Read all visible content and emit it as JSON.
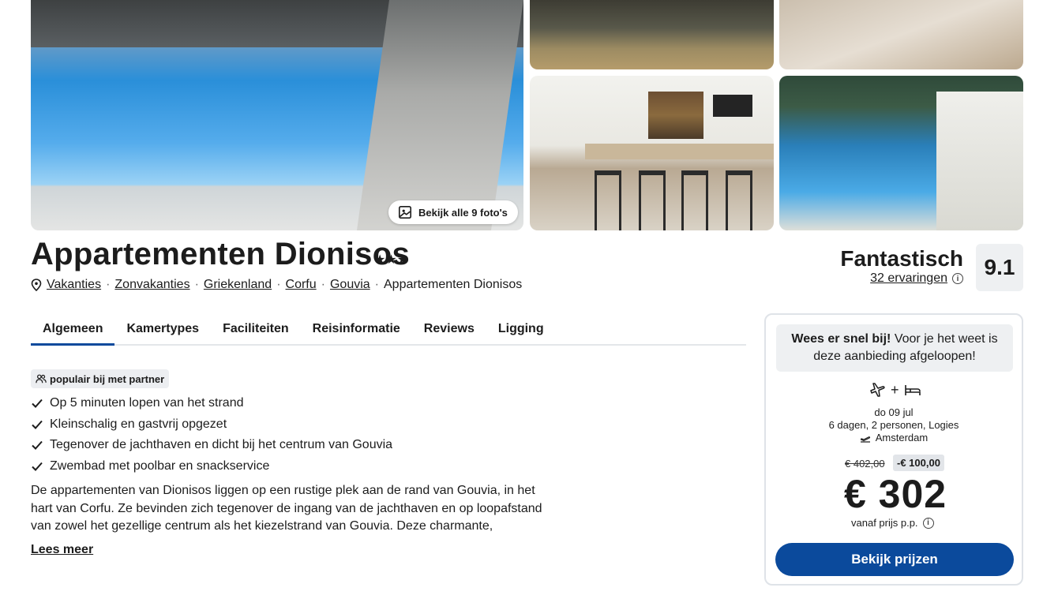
{
  "gallery": {
    "photos_button_label": "Bekijk alle 9 foto's",
    "icon": "images-icon"
  },
  "hotel": {
    "name": "Appartementen Dionisos",
    "stars": "★★★",
    "star_count": 3
  },
  "breadcrumb": {
    "icon": "location-pin-icon",
    "items": [
      "Vakanties",
      "Zonvakanties",
      "Griekenland",
      "Corfu",
      "Gouvia"
    ],
    "current": "Appartementen Dionisos",
    "separator": "·"
  },
  "rating": {
    "label": "Fantastisch",
    "count_text": "32 ervaringen",
    "score": "9.1"
  },
  "tabs": [
    "Algemeen",
    "Kamertypes",
    "Faciliteiten",
    "Reisinformatie",
    "Reviews",
    "Ligging"
  ],
  "active_tab": "Algemeen",
  "badge": "populair bij met partner",
  "usps": [
    "Op 5 minuten lopen van het strand",
    "Kleinschalig en gastvrij opgezet",
    "Tegenover de jachthaven en dicht bij het centrum van Gouvia",
    "Zwembad met poolbar en snackservice"
  ],
  "description": "De appartementen van Dionisos liggen op een rustige plek aan de rand van Gouvia, in het hart van Corfu. Ze bevinden zich tegenover de ingang van de jachthaven en op loopafstand van zowel het gezellige centrum als het kiezelstrand van Gouvia. Deze charmante, kleinschalige accommodatie",
  "read_more": "Lees meer",
  "booking": {
    "hurry_bold": "Wees er snel bij!",
    "hurry_text": " Voor je het weet is deze aanbieding afgeloopen!",
    "plus": "+",
    "date": "do 09 jul",
    "details": "6 dagen, 2 personen, Logies",
    "departure": "Amsterdam",
    "old_price": "€ 402,00",
    "discount": "-€ 100,00",
    "price": "€ 302",
    "price_note": "vanaf prijs p.p.",
    "cta": "Bekijk prijzen",
    "accent": "#0b4a9c"
  }
}
